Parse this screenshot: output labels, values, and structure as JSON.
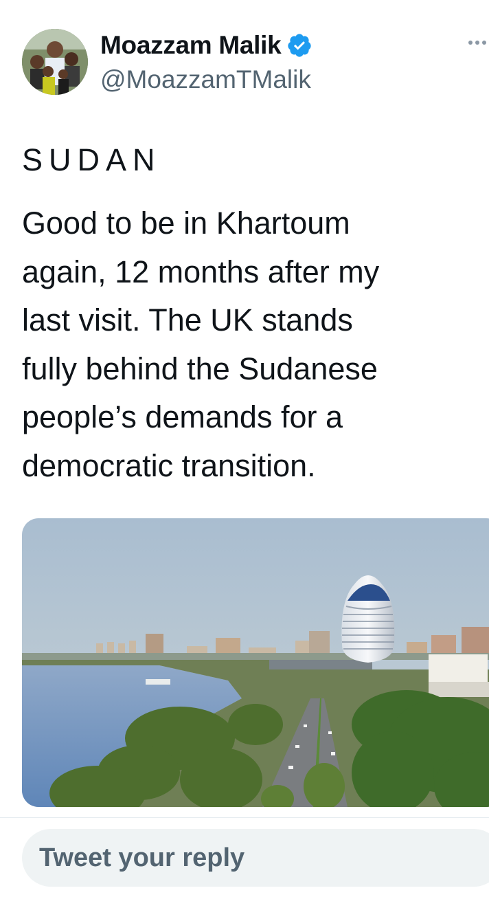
{
  "author": {
    "display_name": "Moazzam Malik",
    "handle": "@MoazzamTMalik",
    "verified": true,
    "verified_color": "#1d9bf0",
    "avatar_icon": "profile-photo-avatar"
  },
  "tweet": {
    "title": "SUDAN",
    "body": "Good to be in Khartoum\nagain, 12 months after my\nlast visit. The UK stands\nfully behind the Sudanese\npeople’s demands for a\ndemocratic transition.",
    "photo_icon": "khartoum-skyline-photo"
  },
  "reply": {
    "placeholder": "Tweet your reply"
  },
  "icons": {
    "more": "more-options-icon",
    "verified": "verified-badge-icon"
  }
}
